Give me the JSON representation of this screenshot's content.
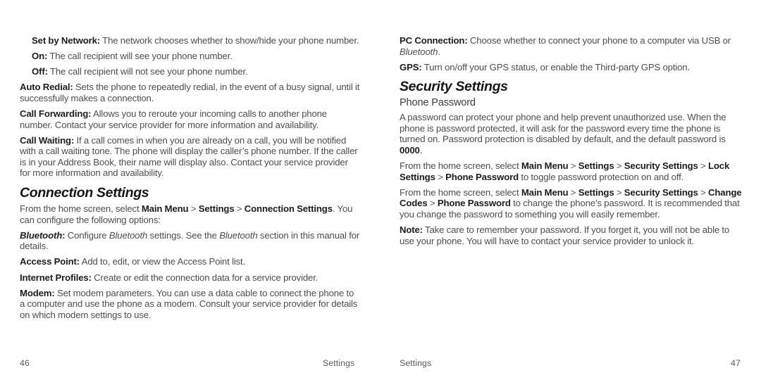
{
  "document": {
    "type": "printed-manual-spread",
    "text_color_body": "#4e4e50",
    "text_color_bold": "#1d1d1f",
    "background": "#ffffff"
  },
  "left_page": {
    "page_number": "46",
    "footer_label": "Settings",
    "blocks": {
      "set_by_network": {
        "term": "Set by Network:",
        "body": " The network chooses whether to show/hide your phone number."
      },
      "on": {
        "term": "On:",
        "body": " The call recipient will see your phone number."
      },
      "off": {
        "term": "Off:",
        "body": " The call recipient will not see your phone number."
      },
      "auto_redial": {
        "term": "Auto Redial:",
        "body": " Sets the phone to repeatedly redial, in the event of a busy signal, until it successfully makes a connection."
      },
      "call_forwarding": {
        "term": "Call Forwarding:",
        "body": " Allows you to reroute your incoming calls to another phone number. Contact your service provider for more information and availability."
      },
      "call_waiting": {
        "term": "Call Waiting:",
        "body": " If a call comes in when you are already on a call, you will be notified with a call waiting tone. The phone will display the caller’s phone number. If the caller is in your Address Book, their name will display also. Contact your service provider for more information and availability."
      },
      "connection_settings_heading": "Connection Settings",
      "connection_path": {
        "lead": "From the home screen, select ",
        "crumb1": "Main Menu",
        "sep1": " > ",
        "crumb2": "Settings",
        "sep2": " > ",
        "crumb3": "Connection Settings",
        "tail": ". You can configure the following options:"
      },
      "bluetooth": {
        "term": "Bluetooth",
        "term_colon": ":",
        "body_a": " Configure ",
        "italic_a": "Bluetooth",
        "body_b": " settings. See the ",
        "italic_b": "Bluetooth",
        "body_c": " section in this manual for details."
      },
      "access_point": {
        "term": "Access Point:",
        "body": " Add to, edit, or view the Access Point list."
      },
      "internet_profiles": {
        "term": "Internet Profiles:",
        "body": " Create or edit the connection data for a service provider."
      },
      "modem": {
        "term": "Modem:",
        "body": " Set modem parameters. You can use a data cable to connect the phone to a computer and use the phone as a modem. Consult your service provider for details on which modem settings to use."
      }
    }
  },
  "right_page": {
    "page_number": "47",
    "footer_label": "Settings",
    "blocks": {
      "pc_connection": {
        "term": "PC Connection:",
        "body_a": " Choose whether to connect your phone to a computer via USB or ",
        "italic_a": "Bluetooth",
        "body_b": "."
      },
      "gps": {
        "term": "GPS:",
        "body": " Turn on/off your GPS status, or enable the Third-party GPS option."
      },
      "security_settings_heading": "Security Settings",
      "phone_password_subheading": "Phone Password",
      "password_intro": {
        "body_a": "A password can protect your phone and help prevent unauthorized use. When the phone is password protected, it will ask for the password every time the phone is turned on. Password protection is disabled by default, and the default password is ",
        "bold_value": "0000",
        "body_b": "."
      },
      "toggle_path": {
        "lead": "From the home screen, select ",
        "crumb1": "Main Menu",
        "sep1": " > ",
        "crumb2": "Settings",
        "sep2": " > ",
        "crumb3": "Security Settings",
        "sep3": " > ",
        "crumb4": "Lock Settings",
        "sep4": " > ",
        "crumb5": "Phone Password",
        "tail": " to toggle password protection on and off."
      },
      "change_path": {
        "lead": "From the home screen, select ",
        "crumb1": "Main Menu",
        "sep1": " > ",
        "crumb2": "Settings",
        "sep2": " > ",
        "crumb3": "Security Settings",
        "sep3": " > ",
        "crumb4": "Change Codes",
        "sep4": " > ",
        "crumb5": "Phone Password",
        "tail": " to change the phone’s password. It is recommended that you change the password to something you will easily remember."
      },
      "note": {
        "term": "Note:",
        "body": " Take care to remember your password. If you forget it, you will not be able to use your phone. You will have to contact your service provider to unlock it."
      }
    }
  }
}
